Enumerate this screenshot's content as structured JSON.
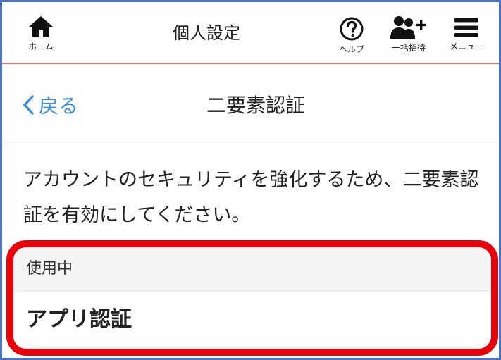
{
  "header": {
    "home_label": "ホーム",
    "title": "個人設定",
    "help_label": "ヘルプ",
    "invite_label": "一括招待",
    "menu_label": "メニュー",
    "icons": [
      "home-icon",
      "help-icon",
      "add-users-icon",
      "menu-icon"
    ]
  },
  "subheader": {
    "back_label": "戻る",
    "title": "二要素認証"
  },
  "description": "アカウントのセキュリティを強化するため、二要素認証を有効にしてください。",
  "section": {
    "header": "使用中",
    "item_label": "アプリ認証"
  },
  "colors": {
    "frame_border": "#4a72c4",
    "header_underline": "#e46a6a",
    "link_blue": "#3d8fd6",
    "highlight_red": "#e8000a"
  }
}
